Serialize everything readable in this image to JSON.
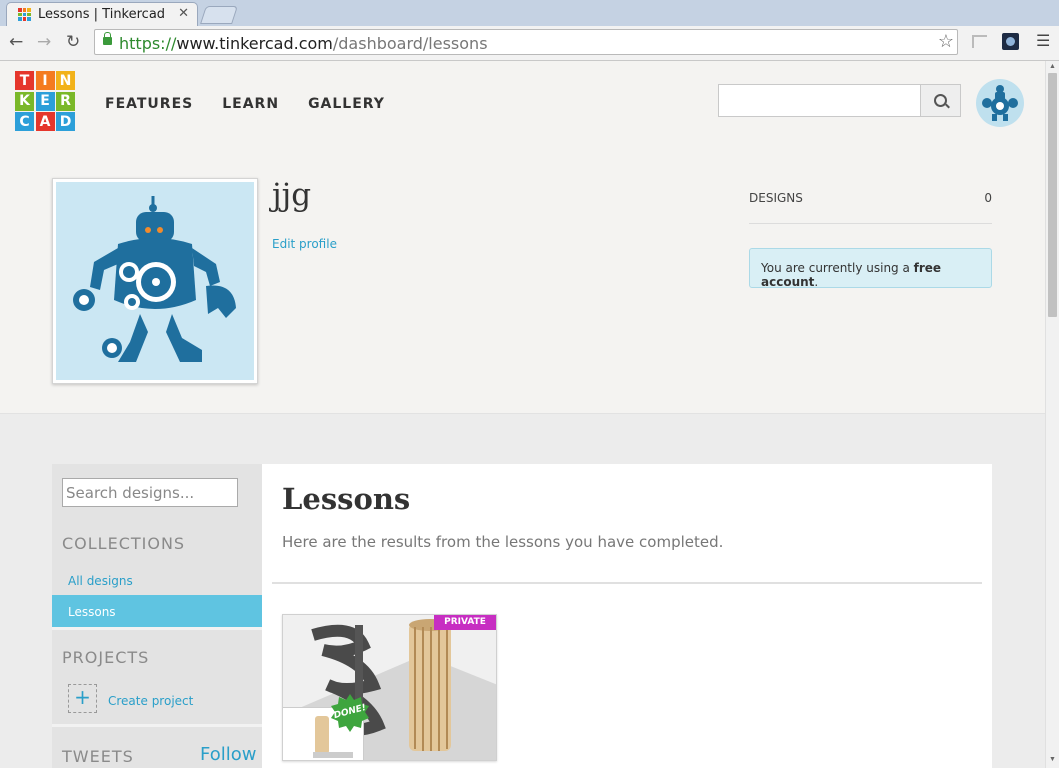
{
  "browser": {
    "tab_title": "Lessons | Tinkercad",
    "tab_close": "✕",
    "url_scheme": "https://",
    "url_host": "www.tinkercad.com",
    "url_path": "/dashboard/lessons"
  },
  "logo": {
    "letters": [
      "T",
      "I",
      "N",
      "K",
      "E",
      "R",
      "C",
      "A",
      "D"
    ],
    "colors": [
      "#e5362c",
      "#f47b20",
      "#f2b21a",
      "#7ab829",
      "#2c9fd9",
      "#7ab829",
      "#2c9fd9",
      "#e5362c",
      "#2c9fd9"
    ]
  },
  "nav": {
    "items": [
      "FEATURES",
      "LEARN",
      "GALLERY"
    ]
  },
  "search": {
    "placeholder": ""
  },
  "profile": {
    "username": "jjg",
    "edit_link": "Edit profile",
    "designs_label": "DESIGNS",
    "designs_count": "0",
    "account_prefix": "You are currently using a ",
    "account_type": "free account",
    "account_suffix": "."
  },
  "sidebar": {
    "search_placeholder": "Search designs...",
    "collections_heading": "COLLECTIONS",
    "items": [
      "All designs",
      "Lessons"
    ],
    "active_item": "Lessons",
    "projects_heading": "PROJECTS",
    "create_plus": "+",
    "create_project": "Create project",
    "tweets_heading": "TWEETS",
    "follow": "Follow"
  },
  "content": {
    "title": "Lessons",
    "subtitle": "Here are the results from the lessons you have completed.",
    "card": {
      "badge": "PRIVATE",
      "done": "DONE!"
    }
  },
  "colors": {
    "accent": "#2a9fc9",
    "active_bg": "#5fc4e1",
    "private_badge": "#c72ec2",
    "done_badge": "#3ea53e",
    "robot": "#1f6f9e"
  }
}
